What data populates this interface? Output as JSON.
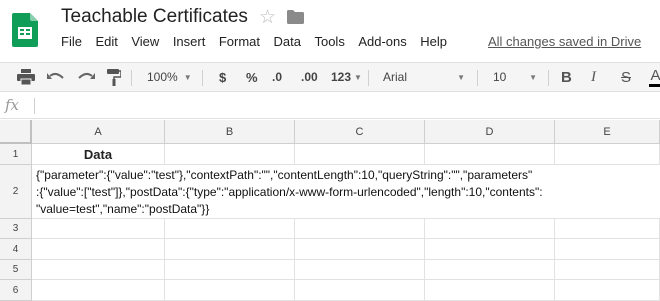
{
  "header": {
    "title": "Teachable Certificates",
    "status": "All changes saved in Drive",
    "star_icon": "star-icon",
    "folder_icon": "folder-icon",
    "logo_icon": "sheets-logo-icon"
  },
  "menu": [
    "File",
    "Edit",
    "View",
    "Insert",
    "Format",
    "Data",
    "Tools",
    "Add-ons",
    "Help"
  ],
  "toolbar": {
    "zoom": "100%",
    "currency": "$",
    "percent": "%",
    "decrease_decimals": ".0",
    "increase_decimals": ".00",
    "more_formats": "123",
    "font": "Arial",
    "font_size": "10",
    "bold": "B",
    "italic": "I",
    "strikethrough": "S",
    "text_color": "A"
  },
  "formula_bar": {
    "fx": "fx",
    "value": ""
  },
  "grid": {
    "columns": [
      "A",
      "B",
      "C",
      "D",
      "E"
    ],
    "rows": [
      "1",
      "2",
      "3",
      "4",
      "5",
      "6"
    ],
    "cells": {
      "A1": "Data",
      "A2": "{\"parameter\":{\"value\":\"test\"},\"contextPath\":\"\",\"contentLength\":10,\"queryString\":\"\",\"parameters\"\n:{\"value\":[\"test\"]},\"postData\":{\"type\":\"application/x-www-form-urlencoded\",\"length\":10,\"contents\":\n\"value=test\",\"name\":\"postData\"}}"
    }
  },
  "colors": {
    "sheets_green": "#0f9d58",
    "header_bg": "#f3f3f3",
    "toolbar_bg": "#f5f5f5",
    "gridline": "#e2e2e2"
  }
}
